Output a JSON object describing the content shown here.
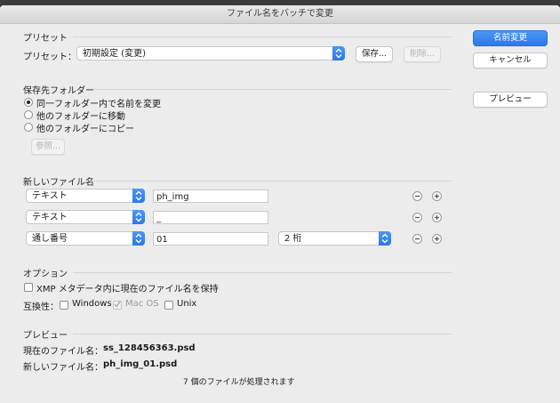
{
  "window": {
    "title": "ファイル名をバッチで変更"
  },
  "buttons": {
    "rename": "名前変更",
    "cancel": "キャンセル",
    "preview": "プレビュー"
  },
  "preset": {
    "section_title": "プリセット",
    "label": "プリセット：",
    "value": "初期設定 (変更)",
    "save": "保存...",
    "delete": "削除..."
  },
  "destination": {
    "section_title": "保存先フォルダー",
    "options": [
      "同一フォルダー内で名前を変更",
      "他のフォルダーに移動",
      "他のフォルダーにコピー"
    ],
    "selected_index": 0,
    "browse": "参照..."
  },
  "new_name": {
    "section_title": "新しいファイル名",
    "rows": [
      {
        "type": "テキスト",
        "value": "ph_img"
      },
      {
        "type": "テキスト",
        "value": "_"
      },
      {
        "type": "通し番号",
        "value": "01",
        "digits": "2 桁"
      }
    ]
  },
  "options": {
    "section_title": "オプション",
    "xmp_label": "XMP メタデータ内に現在のファイル名を保持",
    "compat_label": "互換性：",
    "compat": [
      {
        "label": "Windows",
        "checked": false,
        "disabled": false
      },
      {
        "label": "Mac OS",
        "checked": true,
        "disabled": true
      },
      {
        "label": "Unix",
        "checked": false,
        "disabled": false
      }
    ]
  },
  "preview": {
    "section_title": "プレビュー",
    "current_label": "現在のファイル名：",
    "current_value": "ss_128456363.psd",
    "new_label": "新しいファイル名：",
    "new_value": "ph_img_01.psd",
    "summary": "7 個のファイルが処理されます"
  },
  "colors": {
    "accent": "#2a78ea"
  }
}
